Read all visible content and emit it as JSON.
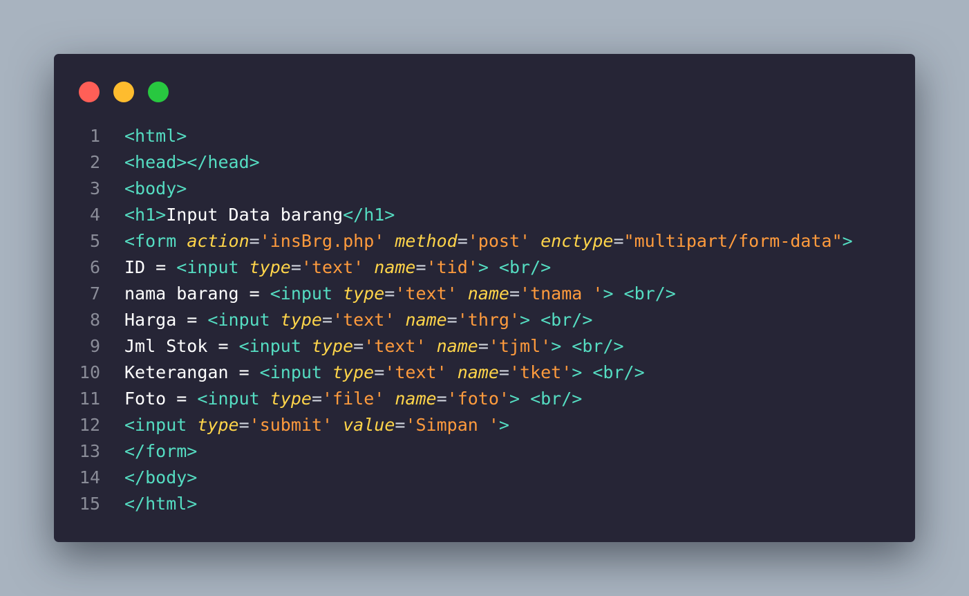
{
  "colors": {
    "page_background": "#a8b3bf",
    "window_background": "#262536",
    "dot_close": "#ff5f57",
    "dot_minimize": "#febc2e",
    "dot_maximize": "#28c840",
    "tag": "#55ddc2",
    "text": "#ffffff",
    "attr": "#ffd54a",
    "punct": "#cfd3dc",
    "string": "#ff9b3d",
    "line_number": "#8a8c98"
  },
  "window_controls": [
    {
      "name": "close-dot",
      "color": "#ff5f57"
    },
    {
      "name": "minimize-dot",
      "color": "#febc2e"
    },
    {
      "name": "maximize-dot",
      "color": "#28c840"
    }
  ],
  "lines": [
    {
      "n": "1",
      "tokens": [
        [
          "tag",
          "<html>"
        ]
      ]
    },
    {
      "n": "2",
      "tokens": [
        [
          "tag",
          "<head></head>"
        ]
      ]
    },
    {
      "n": "3",
      "tokens": [
        [
          "tag",
          "<body>"
        ]
      ]
    },
    {
      "n": "4",
      "tokens": [
        [
          "tag",
          "<h1>"
        ],
        [
          "text",
          "Input Data barang"
        ],
        [
          "tag",
          "</h1>"
        ]
      ]
    },
    {
      "n": "5",
      "tokens": [
        [
          "tag",
          "<form "
        ],
        [
          "attr",
          "action"
        ],
        [
          "punct",
          "="
        ],
        [
          "string",
          "'insBrg.php'"
        ],
        [
          "text",
          " "
        ],
        [
          "attr",
          "method"
        ],
        [
          "punct",
          "="
        ],
        [
          "string",
          "'post'"
        ],
        [
          "text",
          " "
        ],
        [
          "attr",
          "enctype"
        ],
        [
          "punct",
          "="
        ],
        [
          "string",
          "\"multipart/form-data\""
        ],
        [
          "tag",
          ">"
        ]
      ]
    },
    {
      "n": "6",
      "tokens": [
        [
          "text",
          "ID = "
        ],
        [
          "tag",
          "<input "
        ],
        [
          "attr",
          "type"
        ],
        [
          "punct",
          "="
        ],
        [
          "string",
          "'text'"
        ],
        [
          "text",
          " "
        ],
        [
          "attr",
          "name"
        ],
        [
          "punct",
          "="
        ],
        [
          "string",
          "'tid'"
        ],
        [
          "tag",
          "> <br/>"
        ]
      ]
    },
    {
      "n": "7",
      "tokens": [
        [
          "text",
          "nama barang = "
        ],
        [
          "tag",
          "<input "
        ],
        [
          "attr",
          "type"
        ],
        [
          "punct",
          "="
        ],
        [
          "string",
          "'text'"
        ],
        [
          "text",
          " "
        ],
        [
          "attr",
          "name"
        ],
        [
          "punct",
          "="
        ],
        [
          "string",
          "'tnama '"
        ],
        [
          "tag",
          "> <br/>"
        ]
      ]
    },
    {
      "n": "8",
      "tokens": [
        [
          "text",
          "Harga = "
        ],
        [
          "tag",
          "<input "
        ],
        [
          "attr",
          "type"
        ],
        [
          "punct",
          "="
        ],
        [
          "string",
          "'text'"
        ],
        [
          "text",
          " "
        ],
        [
          "attr",
          "name"
        ],
        [
          "punct",
          "="
        ],
        [
          "string",
          "'thrg'"
        ],
        [
          "tag",
          "> <br/>"
        ]
      ]
    },
    {
      "n": "9",
      "tokens": [
        [
          "text",
          "Jml Stok = "
        ],
        [
          "tag",
          "<input "
        ],
        [
          "attr",
          "type"
        ],
        [
          "punct",
          "="
        ],
        [
          "string",
          "'text'"
        ],
        [
          "text",
          " "
        ],
        [
          "attr",
          "name"
        ],
        [
          "punct",
          "="
        ],
        [
          "string",
          "'tjml'"
        ],
        [
          "tag",
          "> <br/>"
        ]
      ]
    },
    {
      "n": "10",
      "tokens": [
        [
          "text",
          "Keterangan = "
        ],
        [
          "tag",
          "<input "
        ],
        [
          "attr",
          "type"
        ],
        [
          "punct",
          "="
        ],
        [
          "string",
          "'text'"
        ],
        [
          "text",
          " "
        ],
        [
          "attr",
          "name"
        ],
        [
          "punct",
          "="
        ],
        [
          "string",
          "'tket'"
        ],
        [
          "tag",
          "> <br/>"
        ]
      ]
    },
    {
      "n": "11",
      "tokens": [
        [
          "text",
          "Foto = "
        ],
        [
          "tag",
          "<input "
        ],
        [
          "attr",
          "type"
        ],
        [
          "punct",
          "="
        ],
        [
          "string",
          "'file'"
        ],
        [
          "text",
          " "
        ],
        [
          "attr",
          "name"
        ],
        [
          "punct",
          "="
        ],
        [
          "string",
          "'foto'"
        ],
        [
          "tag",
          "> <br/>"
        ]
      ]
    },
    {
      "n": "12",
      "tokens": [
        [
          "tag",
          "<input "
        ],
        [
          "attr",
          "type"
        ],
        [
          "punct",
          "="
        ],
        [
          "string",
          "'submit'"
        ],
        [
          "text",
          " "
        ],
        [
          "attr",
          "value"
        ],
        [
          "punct",
          "="
        ],
        [
          "string",
          "'Simpan '"
        ],
        [
          "tag",
          ">"
        ]
      ]
    },
    {
      "n": "13",
      "tokens": [
        [
          "tag",
          "</form>"
        ]
      ]
    },
    {
      "n": "14",
      "tokens": [
        [
          "tag",
          "</body>"
        ]
      ]
    },
    {
      "n": "15",
      "tokens": [
        [
          "tag",
          "</html>"
        ]
      ]
    }
  ]
}
